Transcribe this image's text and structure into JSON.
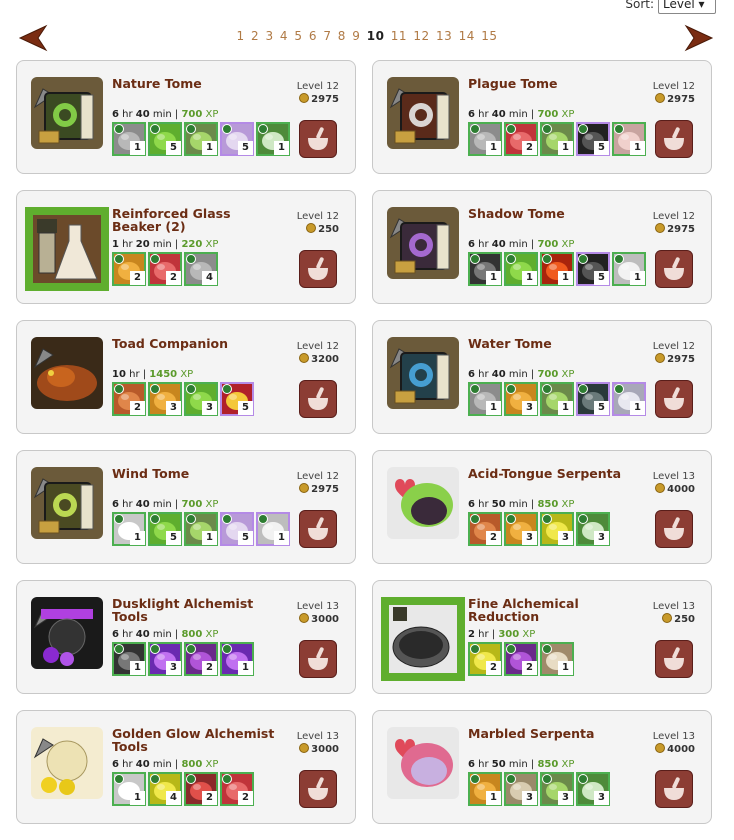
{
  "sort": {
    "label": "Sort:",
    "value": "Level"
  },
  "pagination": {
    "pages": [
      "1",
      "2",
      "3",
      "4",
      "5",
      "6",
      "7",
      "8",
      "9",
      "10",
      "11",
      "12",
      "13",
      "14",
      "15"
    ],
    "current": "10"
  },
  "colors": {
    "accent": "#6b2d14",
    "xp": "#5a9a2a",
    "brew_button": "#8c3d34",
    "arrow": "#7a2c12"
  },
  "cards": [
    {
      "title": "Nature Tome",
      "level": "Level 12",
      "cost": "2975",
      "time_h": "6",
      "time_m": "40",
      "xp": "700",
      "ingredients": [
        {
          "icon": "stone-gray",
          "frame": "green",
          "qty": "1"
        },
        {
          "icon": "slime-green",
          "frame": "green",
          "qty": "5"
        },
        {
          "icon": "vial-green",
          "frame": "green",
          "qty": "1"
        },
        {
          "icon": "pages-purple",
          "frame": "purple",
          "qty": "5"
        },
        {
          "icon": "moss-green",
          "frame": "green",
          "qty": "1"
        }
      ]
    },
    {
      "title": "Plague Tome",
      "level": "Level 12",
      "cost": "2975",
      "time_h": "6",
      "time_m": "40",
      "xp": "700",
      "ingredients": [
        {
          "icon": "stone-gray",
          "frame": "green",
          "qty": "1"
        },
        {
          "icon": "flesh-red",
          "frame": "green",
          "qty": "2"
        },
        {
          "icon": "vial-green",
          "frame": "green",
          "qty": "1"
        },
        {
          "icon": "shadow-black",
          "frame": "purple",
          "qty": "5"
        },
        {
          "icon": "fungus-pink",
          "frame": "green",
          "qty": "1"
        }
      ]
    },
    {
      "title": "Reinforced Glass Beaker (2)",
      "level": "Level 12",
      "cost": "250",
      "time_h": "1",
      "time_m": "20",
      "xp": "220",
      "ingredients": [
        {
          "icon": "amber-orange",
          "frame": "green",
          "qty": "2"
        },
        {
          "icon": "flesh-red",
          "frame": "green",
          "qty": "2"
        },
        {
          "icon": "stone-gray",
          "frame": "green",
          "qty": "4"
        }
      ]
    },
    {
      "title": "Shadow Tome",
      "level": "Level 12",
      "cost": "2975",
      "time_h": "6",
      "time_m": "40",
      "xp": "700",
      "ingredients": [
        {
          "icon": "shadow-dark",
          "frame": "green",
          "qty": "1"
        },
        {
          "icon": "slime-green",
          "frame": "green",
          "qty": "1"
        },
        {
          "icon": "ember-red",
          "frame": "green",
          "qty": "1"
        },
        {
          "icon": "shadow-black",
          "frame": "purple",
          "qty": "5"
        },
        {
          "icon": "bone-white",
          "frame": "green",
          "qty": "1"
        }
      ]
    },
    {
      "title": "Toad Companion",
      "level": "Level 12",
      "cost": "3200",
      "time_h": "10",
      "time_m": "",
      "xp": "1450",
      "ingredients": [
        {
          "icon": "fungus-orange",
          "frame": "green",
          "qty": "2"
        },
        {
          "icon": "amber-orange",
          "frame": "green",
          "qty": "3"
        },
        {
          "icon": "slime-green",
          "frame": "green",
          "qty": "3"
        },
        {
          "icon": "ruby-red",
          "frame": "purple",
          "qty": "5"
        }
      ]
    },
    {
      "title": "Water Tome",
      "level": "Level 12",
      "cost": "2975",
      "time_h": "6",
      "time_m": "40",
      "xp": "700",
      "ingredients": [
        {
          "icon": "stone-gray",
          "frame": "green",
          "qty": "1"
        },
        {
          "icon": "amber-orange",
          "frame": "green",
          "qty": "3"
        },
        {
          "icon": "vial-green",
          "frame": "green",
          "qty": "1"
        },
        {
          "icon": "book-dark",
          "frame": "purple",
          "qty": "5"
        },
        {
          "icon": "shell-white",
          "frame": "purple",
          "qty": "1"
        }
      ]
    },
    {
      "title": "Wind Tome",
      "level": "Level 12",
      "cost": "2975",
      "time_h": "6",
      "time_m": "40",
      "xp": "700",
      "ingredients": [
        {
          "icon": "cloud-white",
          "frame": "green",
          "qty": "1"
        },
        {
          "icon": "slime-green",
          "frame": "green",
          "qty": "5"
        },
        {
          "icon": "vial-green",
          "frame": "green",
          "qty": "1"
        },
        {
          "icon": "pages-purple",
          "frame": "purple",
          "qty": "5"
        },
        {
          "icon": "bone-white",
          "frame": "purple",
          "qty": "1"
        }
      ]
    },
    {
      "title": "Acid-Tongue Serpenta",
      "level": "Level 13",
      "cost": "4000",
      "time_h": "6",
      "time_m": "50",
      "xp": "850",
      "ingredients": [
        {
          "icon": "fungus-orange",
          "frame": "green",
          "qty": "2"
        },
        {
          "icon": "amber-orange",
          "frame": "green",
          "qty": "3"
        },
        {
          "icon": "pollen-yellow",
          "frame": "green",
          "qty": "3"
        },
        {
          "icon": "moss-green",
          "frame": "green",
          "qty": "3"
        }
      ]
    },
    {
      "title": "Dusklight Alchemist Tools",
      "level": "Level 13",
      "cost": "3000",
      "time_h": "6",
      "time_m": "40",
      "xp": "800",
      "ingredients": [
        {
          "icon": "shadow-dark",
          "frame": "green",
          "qty": "1"
        },
        {
          "icon": "crystal-purple",
          "frame": "green",
          "qty": "3"
        },
        {
          "icon": "vial-purple",
          "frame": "green",
          "qty": "2"
        },
        {
          "icon": "crystal-purple",
          "frame": "green",
          "qty": "1"
        }
      ]
    },
    {
      "title": "Fine Alchemical Reduction",
      "level": "Level 13",
      "cost": "250",
      "time_h": "2",
      "time_m": "",
      "xp": "300",
      "ingredients": [
        {
          "icon": "pollen-yellow",
          "frame": "green",
          "qty": "2"
        },
        {
          "icon": "vial-purple",
          "frame": "green",
          "qty": "2"
        },
        {
          "icon": "beaker-tan",
          "frame": "green",
          "qty": "1"
        }
      ]
    },
    {
      "title": "Golden Glow Alchemist Tools",
      "level": "Level 13",
      "cost": "3000",
      "time_h": "6",
      "time_m": "40",
      "xp": "800",
      "ingredients": [
        {
          "icon": "cloud-white",
          "frame": "green",
          "qty": "1"
        },
        {
          "icon": "pollen-yellow",
          "frame": "green",
          "qty": "4"
        },
        {
          "icon": "vial-red",
          "frame": "green",
          "qty": "2"
        },
        {
          "icon": "flesh-red",
          "frame": "green",
          "qty": "2"
        }
      ]
    },
    {
      "title": "Marbled Serpenta",
      "level": "Level 13",
      "cost": "4000",
      "time_h": "6",
      "time_m": "50",
      "xp": "850",
      "ingredients": [
        {
          "icon": "amber-orange",
          "frame": "green",
          "qty": "1"
        },
        {
          "icon": "bone-tan",
          "frame": "green",
          "qty": "3"
        },
        {
          "icon": "vial-green",
          "frame": "green",
          "qty": "3"
        },
        {
          "icon": "moss-green",
          "frame": "green",
          "qty": "3"
        }
      ]
    }
  ],
  "xp_label": "XP"
}
